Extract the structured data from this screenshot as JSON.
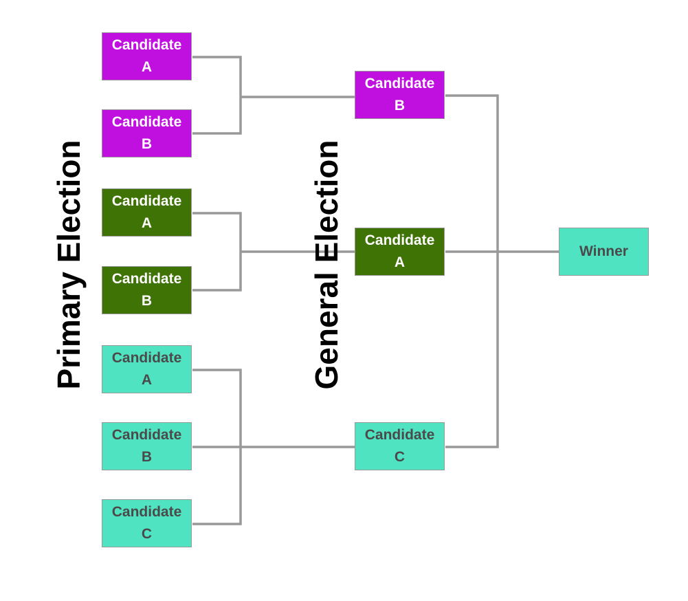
{
  "titles": {
    "primary": "Primary Election",
    "general": "General Election"
  },
  "colors": {
    "party1": "#c010e0",
    "party2": "#3f7305",
    "party3": "#50e3c2",
    "connector": "#999999"
  },
  "primary": [
    {
      "line1": "Candidate",
      "line2": "A",
      "party": "purple"
    },
    {
      "line1": "Candidate",
      "line2": "B",
      "party": "purple"
    },
    {
      "line1": "Candidate",
      "line2": "A",
      "party": "green"
    },
    {
      "line1": "Candidate",
      "line2": "B",
      "party": "green"
    },
    {
      "line1": "Candidate",
      "line2": "A",
      "party": "teal"
    },
    {
      "line1": "Candidate",
      "line2": "B",
      "party": "teal"
    },
    {
      "line1": "Candidate",
      "line2": "C",
      "party": "teal"
    }
  ],
  "general": [
    {
      "line1": "Candidate",
      "line2": "B",
      "party": "purple"
    },
    {
      "line1": "Candidate",
      "line2": "A",
      "party": "green"
    },
    {
      "line1": "Candidate",
      "line2": "C",
      "party": "teal"
    }
  ],
  "winner": {
    "label": "Winner"
  }
}
